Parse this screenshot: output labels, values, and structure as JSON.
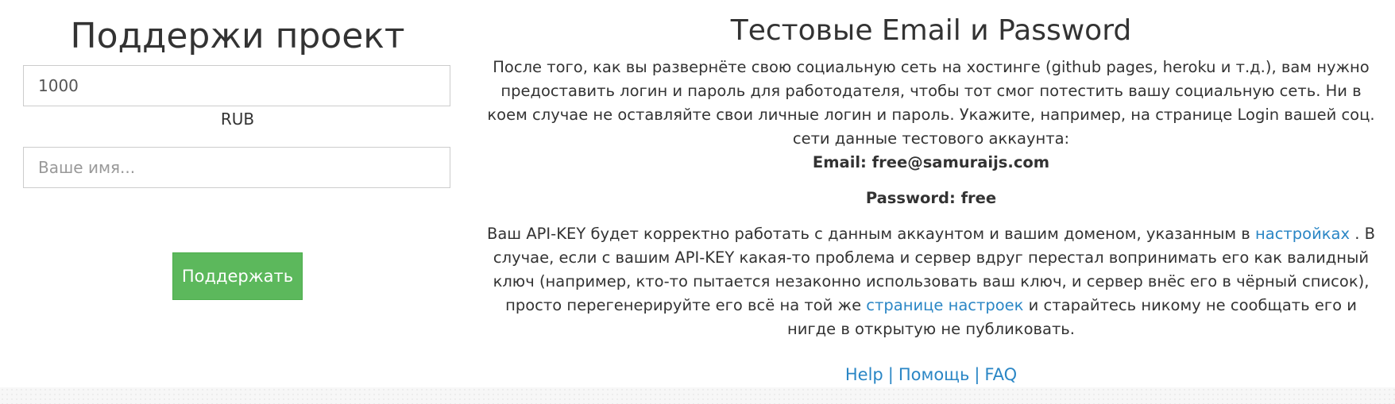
{
  "donate": {
    "title": "Поддержи проект",
    "amount_value": "1000",
    "currency": "RUB",
    "name_placeholder": "Ваше имя...",
    "submit_label": "Поддержать",
    "button_color": "#5cb85c"
  },
  "info": {
    "title": "Тестовые Email и Password",
    "intro": "После того, как вы развернёте свою социальную сеть на хостинге (github pages, heroku и т.д.), вам нужно предоставить логин и пароль для работодателя, чтобы тот смог потестить вашу социальную сеть. Ни в коем случае не оставляйте свои личные логин и пароль. Укажите, например, на странице Login вашей соц. сети данные тестового аккаунта:",
    "email_line": "Email: free@samuraijs.com",
    "password_line": "Password: free",
    "api_part1": "Ваш API-KEY будет корректно работать с данным аккаунтом и вашим доменом, указанным в ",
    "api_link1": "настройках",
    "api_part2": " . В случае, если с вашим API-KEY какая-то проблема и сервер вдруг перестал вопринимать его как валидный ключ (например, кто-то пытается незаконно использовать ваш ключ, и сервер внёс его в чёрный список), просто перегенерируйте его всё на той же ",
    "api_link2": "странице настроек",
    "api_part3": " и старайтесь никому не сообщать его и нигде в открытую не публиковать.",
    "link_color": "#2a86c5"
  },
  "footer": {
    "help": "Help",
    "help_ru": "Помощь",
    "faq": "FAQ",
    "separator": "|"
  }
}
